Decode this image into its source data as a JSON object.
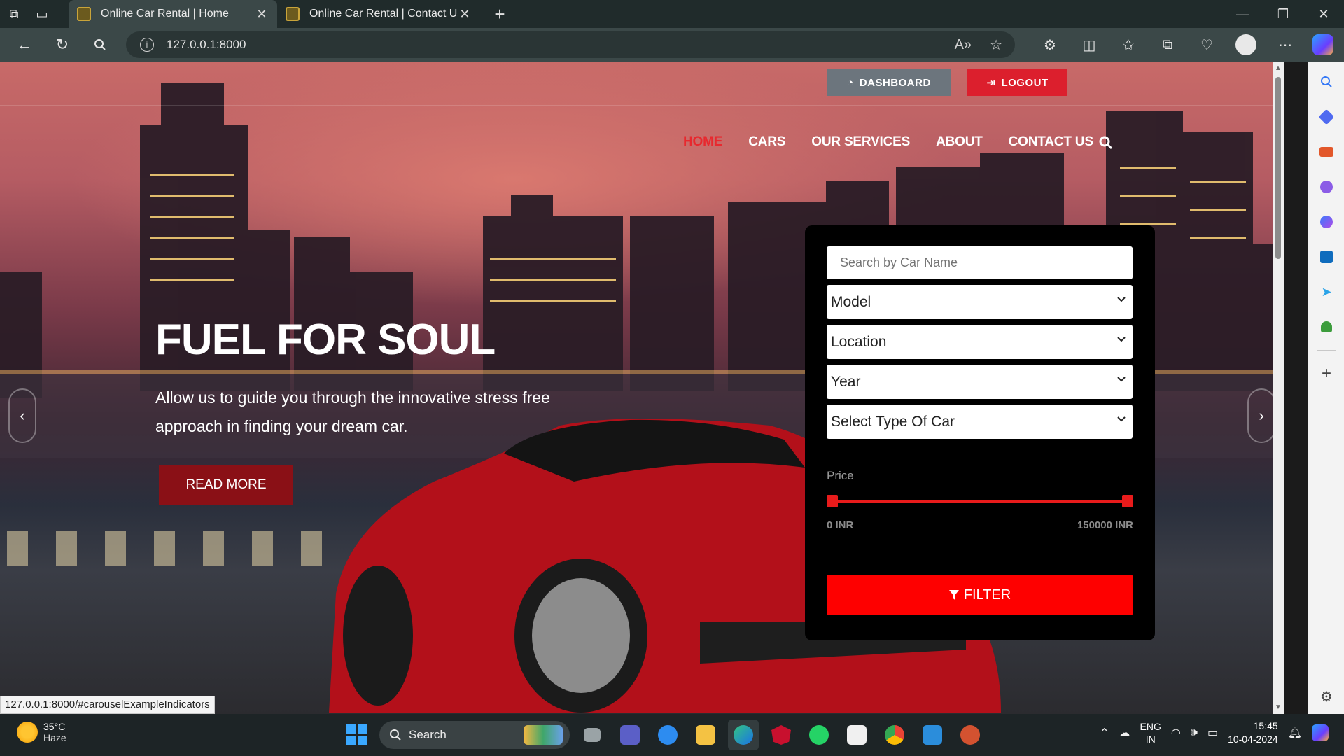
{
  "browser": {
    "tabs": [
      {
        "title": "Online Car Rental | Home",
        "active": true
      },
      {
        "title": "Online Car Rental | Contact Us",
        "active": false
      }
    ],
    "url": "127.0.0.1:8000"
  },
  "header": {
    "dashboard_label": "DASHBOARD",
    "logout_label": "LOGOUT",
    "nav": [
      {
        "label": "HOME",
        "active": true
      },
      {
        "label": "CARS",
        "active": false
      },
      {
        "label": "OUR SERVICES",
        "active": false
      },
      {
        "label": "ABOUT",
        "active": false
      },
      {
        "label": "CONTACT US",
        "active": false
      }
    ]
  },
  "hero": {
    "title": "FUEL FOR SOUL",
    "text": "Allow us to guide you through the innovative stress free approach in finding your dream car.",
    "read_more": "READ MORE"
  },
  "filter": {
    "search_placeholder": "Search by Car Name",
    "model": "Model",
    "location": "Location",
    "year": "Year",
    "type": "Select Type Of Car",
    "price_label": "Price",
    "price_min": "0 INR",
    "price_max": "150000 INR",
    "button": "FILTER"
  },
  "status_bar_url": "127.0.0.1:8000/#carouselExampleIndicators",
  "taskbar": {
    "temp": "35°C",
    "weather": "Haze",
    "search": "Search",
    "lang1": "ENG",
    "lang2": "IN",
    "time": "15:45",
    "date": "10-04-2024"
  },
  "colors": {
    "accent_red": "#e8282e",
    "filter_red": "#fe0000",
    "dashboard_gray": "#6c757d",
    "readmore_red": "#8a1016"
  }
}
